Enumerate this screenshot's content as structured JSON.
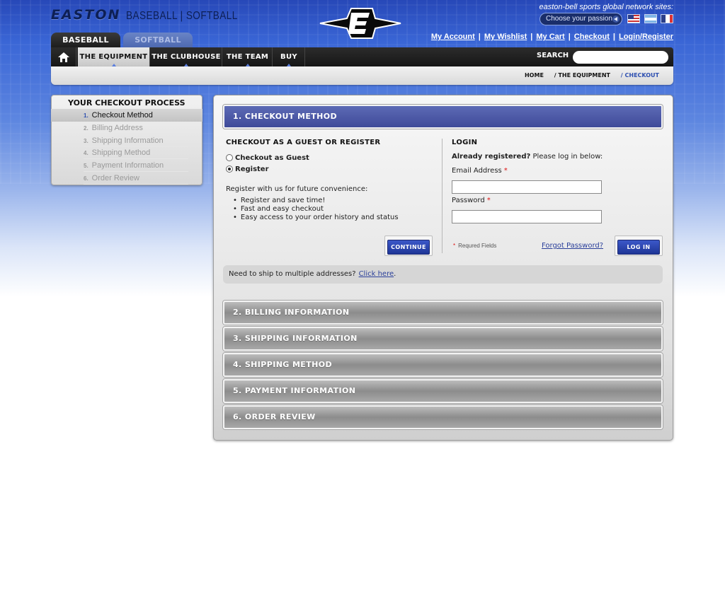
{
  "header": {
    "brand": "EASTON",
    "brand_sub": "BASEBALL | SOFTBALL",
    "network_text": "easton-bell sports global network sites:",
    "passion_select": "Choose your passion",
    "links": [
      "My Account",
      "My Wishlist",
      "My Cart",
      "Checkout",
      "Login/Register"
    ],
    "sport_tabs": [
      "BASEBALL",
      "SOFTBALL"
    ],
    "nav": [
      "THE EQUIPMENT",
      "THE CLUBHOUSE",
      "THE TEAM",
      "BUY"
    ],
    "search_label": "SEARCH",
    "search_value": ""
  },
  "breadcrumb": {
    "home": "HOME",
    "equipment": "/ THE EQUIPMENT",
    "current": "/ CHECKOUT"
  },
  "sidebar": {
    "title": "YOUR CHECKOUT PROCESS",
    "steps": [
      {
        "num": "1.",
        "label": "Checkout Method"
      },
      {
        "num": "2.",
        "label": "Billing Address"
      },
      {
        "num": "3.",
        "label": "Shipping Information"
      },
      {
        "num": "4.",
        "label": "Shipping Method"
      },
      {
        "num": "5.",
        "label": "Payment Information"
      },
      {
        "num": "6.",
        "label": "Order Review"
      }
    ]
  },
  "checkout": {
    "active_section": "1. CHECKOUT METHOD",
    "guest": {
      "heading": "CHECKOUT AS A GUEST OR REGISTER",
      "option_guest": "Checkout as Guest",
      "option_register": "Register",
      "selected": "Register",
      "intro": "Register with us for future convenience:",
      "benefits": [
        "Register and save time!",
        "Fast and easy checkout",
        "Easy access to your order history and status"
      ],
      "continue_label": "CONTINUE"
    },
    "login": {
      "heading": "LOGIN",
      "intro_bold": "Already registered?",
      "intro_rest": "Please log in below:",
      "email_label": "Email Address",
      "password_label": "Password",
      "required_star": "*",
      "email_value": "",
      "password_value": "",
      "required_note": "Requred Fields",
      "forgot_label": "Forgot Password?",
      "login_label": "LOG IN"
    },
    "multi_ship": {
      "text": "Need to ship to multiple addresses?",
      "link": "Click here",
      "after": "."
    },
    "sections": [
      "2. BILLING INFORMATION",
      "3. SHIPPING INFORMATION",
      "4. SHIPPING METHOD",
      "5. PAYMENT INFORMATION",
      "6. ORDER REVIEW"
    ]
  },
  "colors": {
    "brand_navy": "#0d1f55",
    "active_bar": "#3e4a99",
    "link": "#2a3f9a",
    "required": "#d11111"
  }
}
